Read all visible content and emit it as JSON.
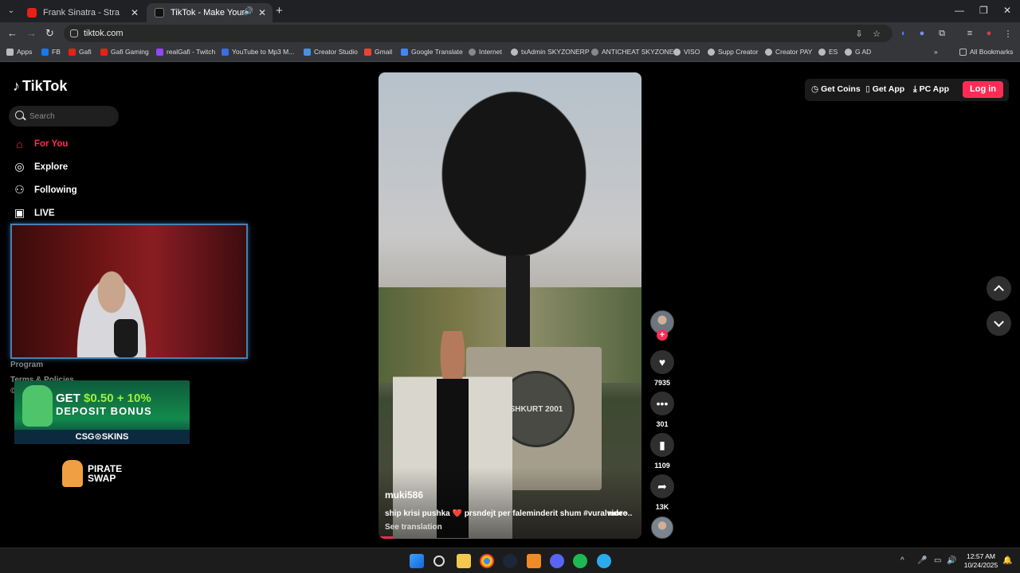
{
  "browser": {
    "tabs": [
      {
        "title": "Frank Sinatra - Strangers In The",
        "favicon_color": "#e62117"
      },
      {
        "title": "TikTok - Make Your Day",
        "favicon_color": "#111111"
      }
    ],
    "url": "tiktok.com",
    "bookmarks": [
      {
        "label": "Apps",
        "color": "#bbbbbb"
      },
      {
        "label": "FB",
        "color": "#1877f2"
      },
      {
        "label": "Gafi",
        "color": "#e62117"
      },
      {
        "label": "Gafi Gaming",
        "color": "#e62117"
      },
      {
        "label": "realGafi - Twitch",
        "color": "#9146ff"
      },
      {
        "label": "YouTube to Mp3 M...",
        "color": "#3b6fe0"
      },
      {
        "label": "Creator Studio",
        "color": "#4a90e2"
      },
      {
        "label": "Gmail",
        "color": "#ea4335"
      },
      {
        "label": "Google Translate",
        "color": "#4285f4"
      },
      {
        "label": "Internet",
        "color": "#888888"
      },
      {
        "label": "txAdmin SKYZONERP",
        "color": "#bbbbbb"
      },
      {
        "label": "ANTICHEAT SKYZONE",
        "color": "#888888"
      },
      {
        "label": "VISO",
        "color": "#bbbbbb"
      },
      {
        "label": "Supp Creator",
        "color": "#bbbbbb"
      },
      {
        "label": "Creator PAY",
        "color": "#bbbbbb"
      },
      {
        "label": "ES",
        "color": "#bbbbbb"
      },
      {
        "label": "G AD",
        "color": "#bbbbbb"
      }
    ],
    "all_bookmarks": "All Bookmarks"
  },
  "tiktok": {
    "brand": "TikTok",
    "search_placeholder": "Search",
    "nav": [
      {
        "label": "For You",
        "icon": "home-icon"
      },
      {
        "label": "Explore",
        "icon": "compass-icon"
      },
      {
        "label": "Following",
        "icon": "following-icon"
      },
      {
        "label": "LIVE",
        "icon": "live-icon"
      }
    ],
    "footer_links": [
      "Program",
      "Terms & Policies",
      "©"
    ],
    "header": {
      "get_coins": "Get Coins",
      "get_app": "Get App",
      "pc_app": "PC App",
      "login": "Log in"
    },
    "video": {
      "author": "muki586",
      "caption": "ship krisi pushka ❤️ prsndejt per faleminderit shum #vuralvideo...",
      "more": "more",
      "see_translation": "See translation",
      "seal_text": "SHKURT 2001"
    },
    "stats": {
      "likes": "7935",
      "comments": "301",
      "saves": "1109",
      "shares": "13K"
    }
  },
  "overlays": {
    "promo_line1_prefix": "GET ",
    "promo_line1_amount": "$0.50 + 10%",
    "promo_line2": "DEPOSIT BONUS",
    "promo_brand": "CSG⊙SKINS",
    "pirate_line1": "PIRATE",
    "pirate_line2": "SWAP"
  },
  "taskbar": {
    "time": "12:57 AM",
    "date": "10/24/2025"
  }
}
